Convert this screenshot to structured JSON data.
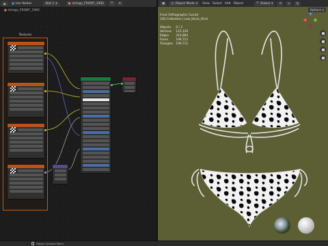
{
  "node_editor": {
    "header": {
      "editor_label": "Use Nodes",
      "slot": "Slot 1",
      "material": "strings_FRONT_1992"
    },
    "breadcrumb": "strings_FRONT_1992",
    "frame_label": "Textures"
  },
  "viewport": {
    "header": {
      "mode": "Object Mode",
      "menus": [
        "View",
        "Select",
        "Add",
        "Object"
      ],
      "transform": "Global",
      "options": "Options"
    },
    "overlay": {
      "view": "Front Orthographic (Local)",
      "collection": "(30) Collection | Low_bikini_thick"
    },
    "stats": [
      {
        "label": "Objects",
        "value": "0 / 3"
      },
      {
        "label": "Vertices",
        "value": "115,129"
      },
      {
        "label": "Edges",
        "value": "314,864"
      },
      {
        "label": "Faces",
        "value": "199,712"
      },
      {
        "label": "Triangles",
        "value": "199,712"
      }
    ],
    "gizmo": {
      "x": "X",
      "y": "Y",
      "z": "Z"
    }
  },
  "status_bar": {
    "context_menu": "Object Context Menu"
  },
  "colors": {
    "viewport_bg": "#5b5f33",
    "frame_orange": "#c85a12",
    "node_green": "#1c7a3a"
  }
}
